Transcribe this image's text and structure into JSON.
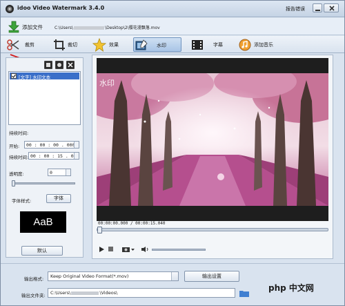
{
  "window": {
    "title": "idoo Video Watermark 3.4.0",
    "report_label": "报告错误"
  },
  "addbar": {
    "add_file_label": "添加文件",
    "file_path_prefix": "C:\\Users\\",
    "file_path_mid": "\\Desktop\\2\\",
    "file_path_suffix": "樱花漫飘落.mov"
  },
  "tabs": [
    {
      "label": "裁剪",
      "icon": "scissors-icon"
    },
    {
      "label": "裁切",
      "icon": "crop-icon"
    },
    {
      "label": "效果",
      "icon": "effects-star-icon"
    },
    {
      "label": "水印",
      "icon": "watermark-icon",
      "active": true
    },
    {
      "label": "字幕",
      "icon": "subtitle-film-icon"
    },
    {
      "label": "添加音乐",
      "icon": "music-icon"
    }
  ],
  "left_panel": {
    "watermark_item": "[文字] 水印文本",
    "duration_label": "持续时间:",
    "start_label": "开始:",
    "start_value": "00 : 00 : 00 . 000",
    "end_label": "持续时间:",
    "end_value": "00 : 00 : 15 . 040",
    "opacity_label": "透明度:",
    "opacity_value": "0",
    "opacity_level": 0,
    "font_style_label": "字体样式:",
    "font_button": "字体",
    "font_preview": "AaB",
    "default_button": "默认"
  },
  "video": {
    "watermark_text": "水印",
    "timecode": "00:00:00.000 / 00:00:15.040",
    "progress": 0
  },
  "bottom": {
    "output_format_label": "输出格式:",
    "output_format_value": "Keep Original Video Format(*.mov)",
    "output_settings_button": "输出设置",
    "output_folder_label": "输出文件夹:",
    "output_folder_prefix": "C:\\Users\\",
    "output_folder_suffix": "\\Videos\\"
  },
  "brand": "php 中文网",
  "colors": {
    "accent": "#3a6fc9",
    "annotation_arrow": "#d21c1c",
    "blossom": "#d97fb0"
  }
}
